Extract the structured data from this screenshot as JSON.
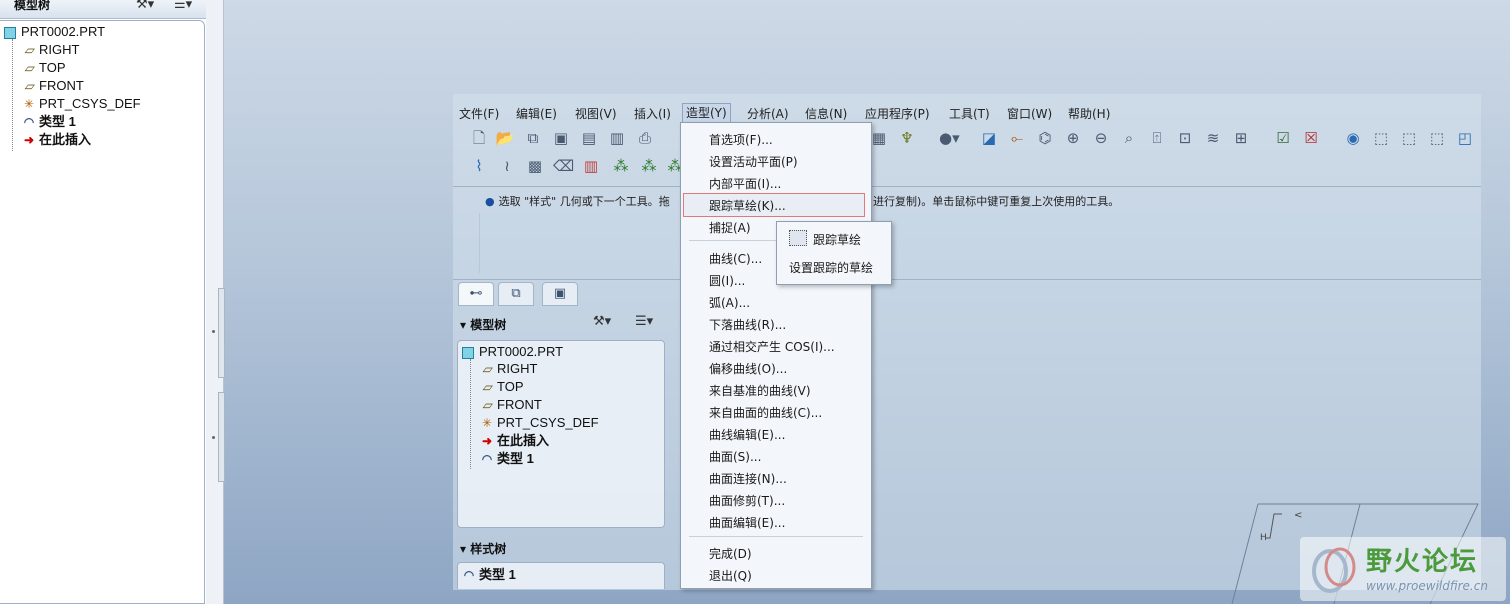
{
  "left_panel": {
    "title": "模型树",
    "tree": [
      {
        "label": "PRT0002.PRT",
        "icon": "part-icon"
      },
      {
        "label": "RIGHT",
        "icon": "datum-plane-icon"
      },
      {
        "label": "TOP",
        "icon": "datum-plane-icon"
      },
      {
        "label": "FRONT",
        "icon": "datum-plane-icon"
      },
      {
        "label": "PRT_CSYS_DEF",
        "icon": "csys-icon"
      },
      {
        "label": "类型 1",
        "icon": "style-feature-icon"
      },
      {
        "label": "在此插入",
        "icon": "insert-here-arrow-icon"
      }
    ]
  },
  "menubar": {
    "items": [
      "文件(F)",
      "编辑(E)",
      "视图(V)",
      "插入(I)",
      "造型(Y)",
      "分析(A)",
      "信息(N)",
      "应用程序(P)",
      "工具(T)",
      "窗口(W)",
      "帮助(H)"
    ],
    "active_index": 4
  },
  "message": {
    "part1": "选取 \"样式\" 几何或下一个工具。拖",
    "part2": "进行复制)。单击鼠标中键可重复上次使用的工具。"
  },
  "nav_panel": {
    "model_tree_title": "模型树",
    "tree": [
      {
        "label": "PRT0002.PRT",
        "icon": "part-icon"
      },
      {
        "label": "RIGHT",
        "icon": "datum-plane-icon"
      },
      {
        "label": "TOP",
        "icon": "datum-plane-icon"
      },
      {
        "label": "FRONT",
        "icon": "datum-plane-icon"
      },
      {
        "label": "PRT_CSYS_DEF",
        "icon": "csys-icon"
      },
      {
        "label": "在此插入",
        "icon": "insert-here-arrow-icon"
      },
      {
        "label": "类型 1",
        "icon": "style-feature-icon"
      }
    ],
    "style_tree_title": "样式树",
    "style_tree": [
      {
        "label": "类型 1",
        "icon": "style-feature-icon"
      }
    ]
  },
  "dropdown": {
    "items": [
      "首选项(F)...",
      "设置活动平面(P)",
      "内部平面(I)...",
      "跟踪草绘(K)...",
      "捕捉(A)",
      "曲线(C)...",
      "圆(I)...",
      "弧(A)...",
      "下落曲线(R)...",
      "通过相交产生 COS(I)...",
      "偏移曲线(O)...",
      "来自基准的曲线(V)",
      "来自曲面的曲线(C)...",
      "曲线编辑(E)...",
      "曲面(S)...",
      "曲面连接(N)...",
      "曲面修剪(T)...",
      "曲面编辑(E)...",
      "完成(D)",
      "退出(Q)"
    ],
    "highlighted_index": 3
  },
  "submenu": {
    "items": [
      "跟踪草绘",
      "设置跟踪的草绘"
    ]
  },
  "watermark": {
    "title": "野火论坛",
    "url": "www.proewildfire.cn"
  }
}
